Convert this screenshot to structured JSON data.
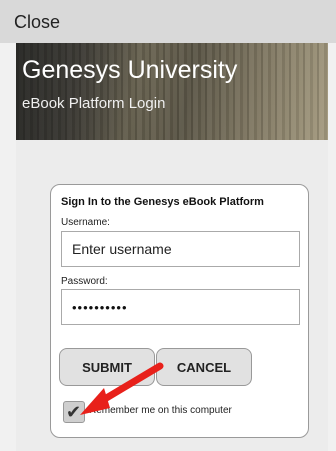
{
  "topbar": {
    "close_label": "Close"
  },
  "banner": {
    "title": "Genesys University",
    "subtitle": "eBook Platform Login"
  },
  "form": {
    "title": "Sign In to the Genesys eBook Platform",
    "username_label": "Username:",
    "username_placeholder": "Enter username",
    "password_label": "Password:",
    "password_value": "••••••••••",
    "submit_label": "SUBMIT",
    "cancel_label": "CANCEL",
    "remember_label": "Remember me on this computer",
    "remember_checked": true
  },
  "annotation": {
    "arrow_color": "#e8201a"
  }
}
